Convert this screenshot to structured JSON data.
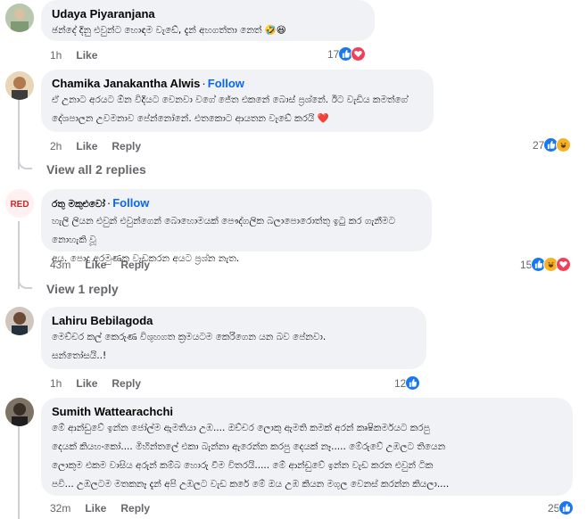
{
  "comments": [
    {
      "name": "Udaya Piyaranjana",
      "follow": "",
      "lines": [
        "ඡන්දේ දිනු එවුන්ට හොඳම වැඩේ, දැන් අහගත්තා නෙත් 🤣😆"
      ],
      "time": "1h",
      "like": "Like",
      "reply": "",
      "count": "17",
      "reactions": [
        "like-icon",
        "love-icon"
      ]
    },
    {
      "name": "Chamika Janakantha Alwis",
      "follow": "Follow",
      "lines": [
        "ඒ උනාට අරයට ඕන විදියට වෙනවා වගේ ජේත එකනේ බොස් ප්‍රශ්නේ. ඊට වැඩිය කමත්ගේ",
        "දේශපාලන උවමනාව පේන්නෝනේ. එතකොට ආයතන වැඩේ කරයි ❤️"
      ],
      "time": "2h",
      "like": "Like",
      "reply": "Reply",
      "count": "27",
      "reactions": [
        "like-icon",
        "haha-icon"
      ]
    },
    {
      "name": "රතු මකුළුවෝ",
      "follow": "Follow",
      "lines": [
        "හැලි ලියන එවුන් එවුන්ගෙන් බොහොමයක් පෞද්ගලික බලාපොරොත්තු ඉටු කර ගැනීමට නොහැකි වූ",
        "අය. පොදු අරමුණක වැඩකරන අයට ප්‍රශ්න නැත."
      ],
      "time": "43m",
      "like": "Like",
      "reply": "Reply",
      "count": "15",
      "reactions": [
        "like-icon",
        "haha-icon",
        "love-icon"
      ]
    },
    {
      "name": "Lahiru Bebilagoda",
      "follow": "",
      "lines": [
        "මෙච්චර කල් කෙරුණ විශුහගත ක්‍රමයටම කෙරිගෙන යන බව පේනවා.",
        "සන්තෝසයි..!"
      ],
      "time": "1h",
      "like": "Like",
      "reply": "Reply",
      "count": "12",
      "reactions": [
        "like-icon"
      ]
    },
    {
      "name": "Sumith Wattearachchi",
      "follow": "",
      "lines": [
        "මේ ආන්ඩුවේ ඉන්න ජෝල්ම ඇමතියා උඹ.... ඔච්චර ලොකු ඇමති කමක් අරන් කෘෂිකර්මයට කරපු",
        "දෙයක් කියහංකෝ.... මිහින්තලේ එකා බැන්නා ඇරෙන්න කරපු දෙයක් නෑ..... මේරුවේ උඹලට තියෙන",
        "ලොකුම එකම වාසිය අරුන් කම්බ හොරු වීම විතරයි..... මේ ආන්ඩුවේ ඉන්න වැඩ කරන එවුන් ටික",
        "පවි... උඹලටම මතකනෑ දැන් අපි උඹලට වැඩ කරේ මේ ඔය උඹ කියන මගුල වෙනස් කරන්න කියලා...."
      ],
      "time": "32m",
      "like": "Like",
      "reply": "Reply",
      "count": "25",
      "reactions": [
        "like-icon"
      ]
    }
  ],
  "view_replies": [
    "View all 2 replies",
    "View 1 reply"
  ],
  "colors": {
    "accent": "#0866ff",
    "bubble": "#f0f2f5",
    "muted": "#65676b",
    "like": "#1877f2",
    "love": "#f33e58",
    "haha": "#f7b125"
  },
  "avatar_badge": "RED"
}
